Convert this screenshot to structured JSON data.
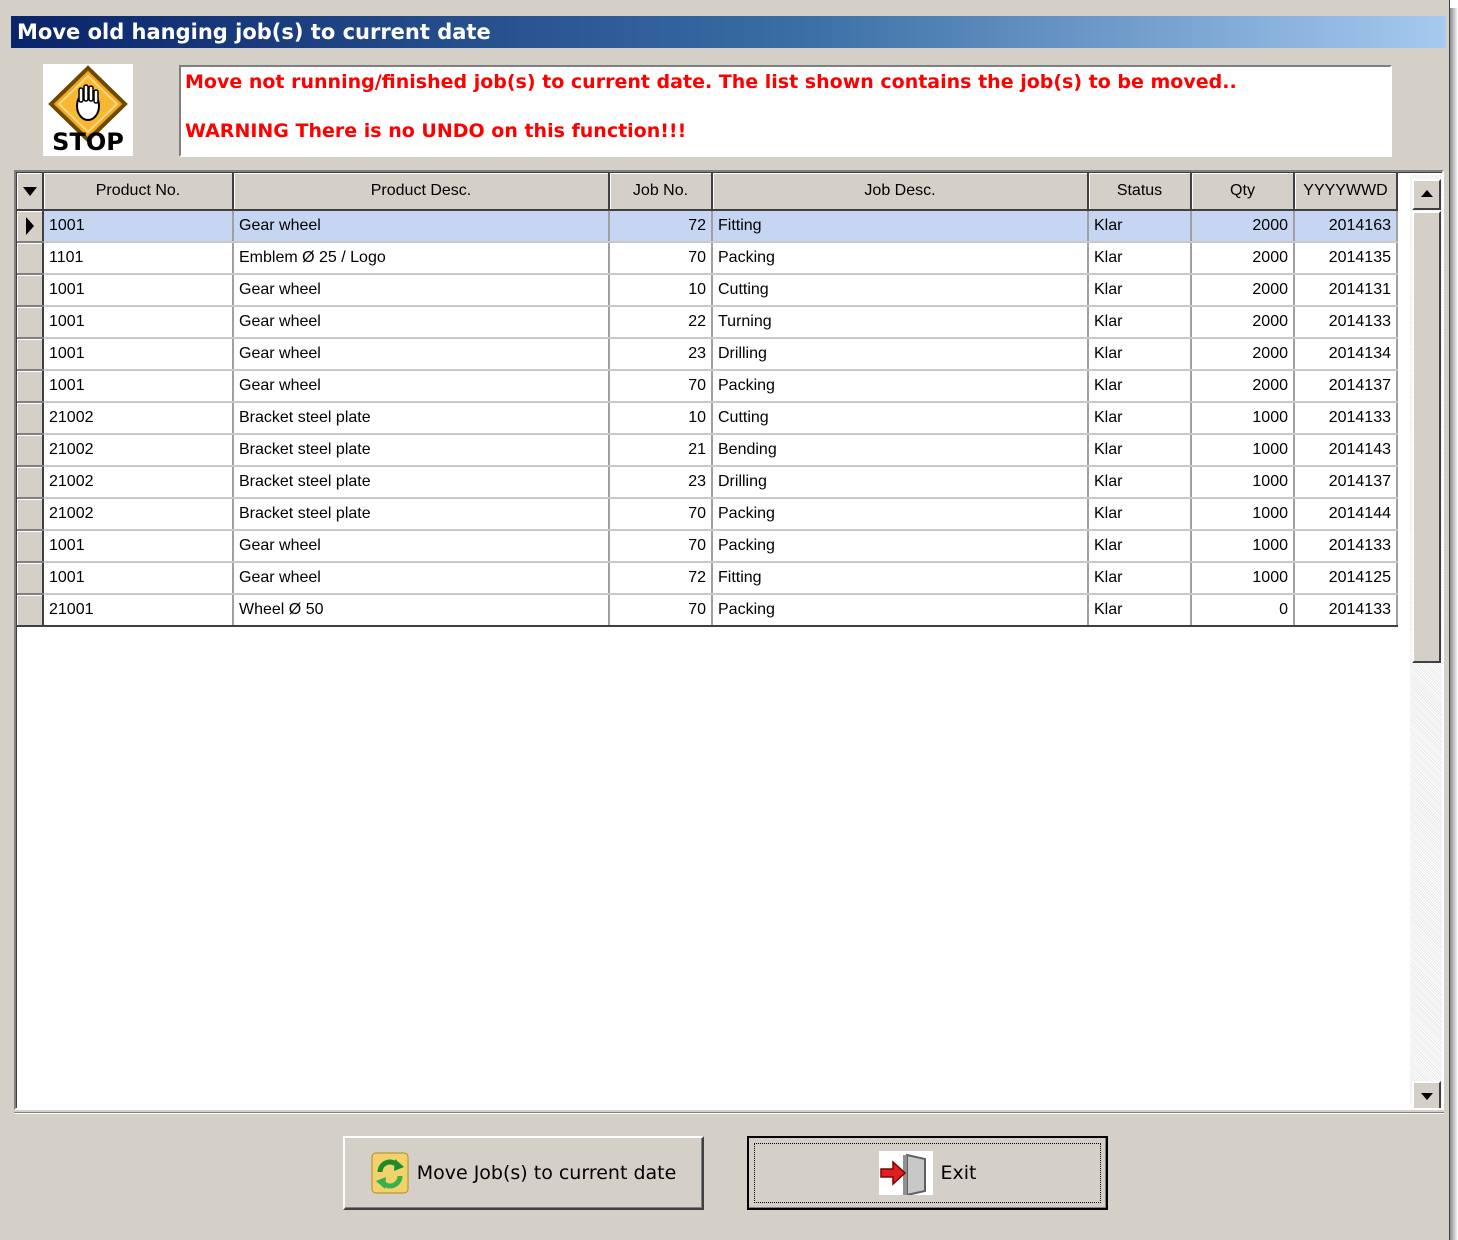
{
  "window": {
    "title": "Move old hanging job(s) to current date"
  },
  "message": {
    "line1": "Move not running/finished job(s) to current date. The list shown contains the job(s) to be moved..",
    "line2": "WARNING There is no UNDO on this function!!!",
    "color": "#ff0000",
    "icon": "stop-hand-icon",
    "icon_text": "STOP"
  },
  "grid": {
    "columns": [
      "Product No.",
      "Product Desc.",
      "Job No.",
      "Job Desc.",
      "Status",
      "Qty",
      "YYYYWWD"
    ],
    "selected_row": 0,
    "rows": [
      [
        "1001",
        "Gear wheel",
        "72",
        "Fitting",
        "Klar",
        "2000",
        "2014163"
      ],
      [
        "1101",
        "Emblem Ø 25 / Logo",
        "70",
        "Packing",
        "Klar",
        "2000",
        "2014135"
      ],
      [
        "1001",
        "Gear wheel",
        "10",
        "Cutting",
        "Klar",
        "2000",
        "2014131"
      ],
      [
        "1001",
        "Gear wheel",
        "22",
        "Turning",
        "Klar",
        "2000",
        "2014133"
      ],
      [
        "1001",
        "Gear wheel",
        "23",
        "Drilling",
        "Klar",
        "2000",
        "2014134"
      ],
      [
        "1001",
        "Gear wheel",
        "70",
        "Packing",
        "Klar",
        "2000",
        "2014137"
      ],
      [
        "21002",
        "Bracket steel plate",
        "10",
        "Cutting",
        "Klar",
        "1000",
        "2014133"
      ],
      [
        "21002",
        "Bracket steel plate",
        "21",
        "Bending",
        "Klar",
        "1000",
        "2014143"
      ],
      [
        "21002",
        "Bracket steel plate",
        "23",
        "Drilling",
        "Klar",
        "1000",
        "2014137"
      ],
      [
        "21002",
        "Bracket steel plate",
        "70",
        "Packing",
        "Klar",
        "1000",
        "2014144"
      ],
      [
        "1001",
        "Gear wheel",
        "70",
        "Packing",
        "Klar",
        "1000",
        "2014133"
      ],
      [
        "1001",
        "Gear wheel",
        "72",
        "Fitting",
        "Klar",
        "1000",
        "2014125"
      ],
      [
        "21001",
        "Wheel Ø 50",
        "70",
        "Packing",
        "Klar",
        "0",
        "2014133"
      ]
    ],
    "selected_color": "#c6d6f2"
  },
  "buttons": {
    "move_label": "Move Job(s) to current date",
    "move_icon": "refresh-arrows-icon",
    "exit_label": "Exit",
    "exit_icon": "exit-door-icon"
  }
}
